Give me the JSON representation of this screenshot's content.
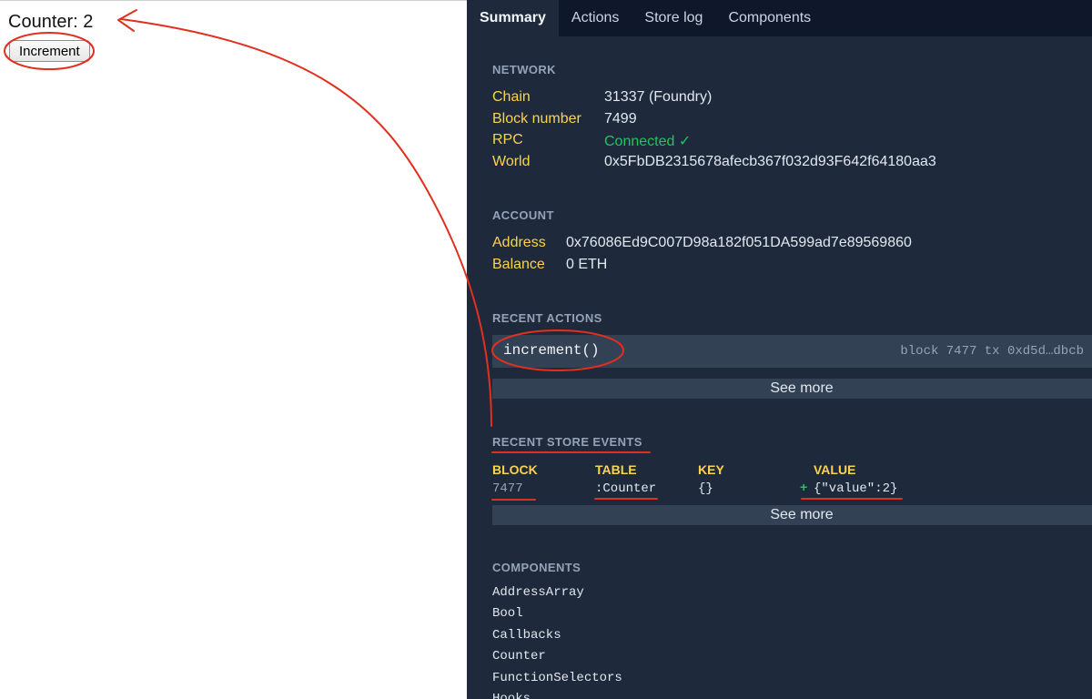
{
  "app": {
    "counter_label": "Counter: 2",
    "increment_label": "Increment"
  },
  "devtools": {
    "tabs": [
      {
        "label": "Summary",
        "active": true
      },
      {
        "label": "Actions",
        "active": false
      },
      {
        "label": "Store log",
        "active": false
      },
      {
        "label": "Components",
        "active": false
      }
    ],
    "network": {
      "title": "NETWORK",
      "rows": [
        {
          "key": "Chain",
          "value": "31337 (Foundry)"
        },
        {
          "key": "Block number",
          "value": "7499"
        },
        {
          "key": "RPC",
          "value": "Connected ✓"
        },
        {
          "key": "World",
          "value": "0x5FbDB2315678afecb367f032d93F642f64180aa3"
        }
      ]
    },
    "account": {
      "title": "ACCOUNT",
      "rows": [
        {
          "key": "Address",
          "value": "0x76086Ed9C007D98a182f051DA599ad7e89569860"
        },
        {
          "key": "Balance",
          "value": "0 ETH"
        }
      ]
    },
    "recent_actions": {
      "title": "RECENT ACTIONS",
      "items": [
        {
          "name": "increment()",
          "meta": "block 7477 tx 0xd5d…dbcb",
          "status": "✓"
        }
      ],
      "see_more": "See more"
    },
    "recent_store_events": {
      "title": "RECENT STORE EVENTS",
      "columns": [
        "BLOCK",
        "TABLE",
        "KEY",
        "VALUE"
      ],
      "rows": [
        {
          "block": "7477",
          "table": ":Counter",
          "key": "{}",
          "op": "+",
          "value": "{\"value\":2}"
        }
      ],
      "see_more": "See more"
    },
    "components": {
      "title": "COMPONENTS",
      "items": [
        "AddressArray",
        "Bool",
        "Callbacks",
        "Counter",
        "FunctionSelectors",
        "Hooks"
      ]
    }
  },
  "colors": {
    "panel_bg": "#1e293b",
    "tabbar_bg": "#0f172a",
    "row_bg": "#334155",
    "key_color": "#fcd34d",
    "ok_color": "#22c55e",
    "annotation_red": "#e0301e"
  }
}
